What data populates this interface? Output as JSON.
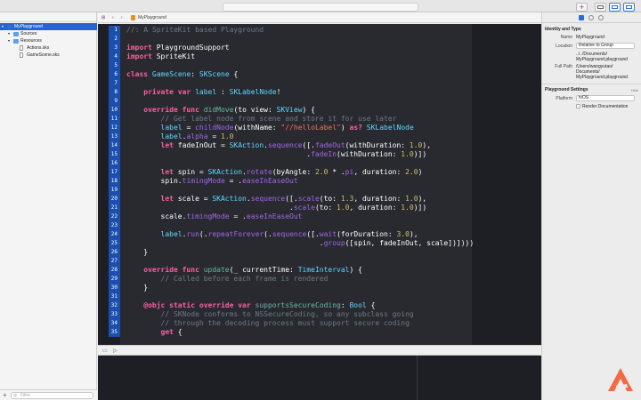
{
  "jumpbar": {
    "project": "MyPlayground"
  },
  "navigator": {
    "items": [
      {
        "label": "MyPlayground",
        "level": 0,
        "icon": "project-icon",
        "selected": true
      },
      {
        "label": "Sources",
        "level": 1,
        "icon": "folder-icon"
      },
      {
        "label": "Resources",
        "level": 1,
        "icon": "folder-icon"
      },
      {
        "label": "Actions.sks",
        "level": 2,
        "icon": "file-icon"
      },
      {
        "label": "GameScene.sks",
        "level": 2,
        "icon": "file-icon"
      }
    ],
    "filter_placeholder": "Filter"
  },
  "editor": {
    "lines": [
      [
        [
          "cm",
          "//: A SpriteKit based Playground"
        ]
      ],
      [],
      [
        [
          "kw",
          "import"
        ],
        [
          "pl",
          " PlaygroundSupport"
        ]
      ],
      [
        [
          "kw",
          "import"
        ],
        [
          "pl",
          " SpriteKit"
        ]
      ],
      [],
      [
        [
          "kw",
          "class"
        ],
        [
          "pl",
          " "
        ],
        [
          "ty",
          "GameScene"
        ],
        [
          "pl",
          ": "
        ],
        [
          "ty",
          "SKScene"
        ],
        [
          "pl",
          " {"
        ]
      ],
      [],
      [
        [
          "pl",
          "    "
        ],
        [
          "kw",
          "private var"
        ],
        [
          "pl",
          " "
        ],
        [
          "ty",
          "label"
        ],
        [
          "pl",
          " : "
        ],
        [
          "ty",
          "SKLabelNode"
        ],
        [
          "pl",
          "!"
        ]
      ],
      [],
      [
        [
          "pl",
          "    "
        ],
        [
          "kw",
          "override func"
        ],
        [
          "pl",
          " "
        ],
        [
          "fn",
          "didMove"
        ],
        [
          "pl",
          "(to view: "
        ],
        [
          "ty",
          "SKView"
        ],
        [
          "pl",
          ") {"
        ]
      ],
      [
        [
          "pl",
          "        "
        ],
        [
          "cm",
          "// Get label node from scene and store it for use later"
        ]
      ],
      [
        [
          "pl",
          "        "
        ],
        [
          "ty",
          "label"
        ],
        [
          "pl",
          " = "
        ],
        [
          "mb",
          "childNode"
        ],
        [
          "pl",
          "(withName: "
        ],
        [
          "st",
          "\"//helloLabel\""
        ],
        [
          "pl",
          ") "
        ],
        [
          "kw",
          "as?"
        ],
        [
          "pl",
          " "
        ],
        [
          "ty",
          "SKLabelNode"
        ]
      ],
      [
        [
          "pl",
          "        "
        ],
        [
          "ty",
          "label"
        ],
        [
          "pl",
          "."
        ],
        [
          "mb",
          "alpha"
        ],
        [
          "pl",
          " = "
        ],
        [
          "nu",
          "1.0"
        ]
      ],
      [
        [
          "pl",
          "        "
        ],
        [
          "kw",
          "let"
        ],
        [
          "pl",
          " fadeInOut = "
        ],
        [
          "ty",
          "SKAction"
        ],
        [
          "pl",
          "."
        ],
        [
          "mb",
          "sequence"
        ],
        [
          "pl",
          "([."
        ],
        [
          "mb",
          "fadeOut"
        ],
        [
          "pl",
          "(withDuration: "
        ],
        [
          "nu",
          "1.0"
        ],
        [
          "pl",
          "),"
        ]
      ],
      [
        [
          "pl",
          "                                          ."
        ],
        [
          "mb",
          "fadeIn"
        ],
        [
          "pl",
          "(withDuration: "
        ],
        [
          "nu",
          "1.0"
        ],
        [
          "pl",
          ")])"
        ]
      ],
      [],
      [
        [
          "pl",
          "        "
        ],
        [
          "kw",
          "let"
        ],
        [
          "pl",
          " spin = "
        ],
        [
          "ty",
          "SKAction"
        ],
        [
          "pl",
          "."
        ],
        [
          "mb",
          "rotate"
        ],
        [
          "pl",
          "(byAngle: "
        ],
        [
          "nu",
          "2.0"
        ],
        [
          "pl",
          " * ."
        ],
        [
          "mb",
          "pi"
        ],
        [
          "pl",
          ", duration: "
        ],
        [
          "nu",
          "2.0"
        ],
        [
          "pl",
          ")"
        ]
      ],
      [
        [
          "pl",
          "        spin."
        ],
        [
          "mb",
          "timingMode"
        ],
        [
          "pl",
          " = ."
        ],
        [
          "mb",
          "easeInEaseOut"
        ]
      ],
      [],
      [
        [
          "pl",
          "        "
        ],
        [
          "kw",
          "let"
        ],
        [
          "pl",
          " scale = "
        ],
        [
          "ty",
          "SKAction"
        ],
        [
          "pl",
          "."
        ],
        [
          "mb",
          "sequence"
        ],
        [
          "pl",
          "([."
        ],
        [
          "mb",
          "scale"
        ],
        [
          "pl",
          "(to: "
        ],
        [
          "nu",
          "1.3"
        ],
        [
          "pl",
          ", duration: "
        ],
        [
          "nu",
          "1.0"
        ],
        [
          "pl",
          "),"
        ]
      ],
      [
        [
          "pl",
          "                                      ."
        ],
        [
          "mb",
          "scale"
        ],
        [
          "pl",
          "(to: "
        ],
        [
          "nu",
          "1.0"
        ],
        [
          "pl",
          ", duration: "
        ],
        [
          "nu",
          "1.0"
        ],
        [
          "pl",
          ")])"
        ]
      ],
      [
        [
          "pl",
          "        scale."
        ],
        [
          "mb",
          "timingMode"
        ],
        [
          "pl",
          " = ."
        ],
        [
          "mb",
          "easeInEaseOut"
        ]
      ],
      [],
      [
        [
          "pl",
          "        "
        ],
        [
          "ty",
          "label"
        ],
        [
          "pl",
          "."
        ],
        [
          "mb",
          "run"
        ],
        [
          "pl",
          "(."
        ],
        [
          "mb",
          "repeatForever"
        ],
        [
          "pl",
          "(."
        ],
        [
          "mb",
          "sequence"
        ],
        [
          "pl",
          "([."
        ],
        [
          "mb",
          "wait"
        ],
        [
          "pl",
          "(forDuration: "
        ],
        [
          "nu",
          "3.0"
        ],
        [
          "pl",
          "),"
        ]
      ],
      [
        [
          "pl",
          "                                             ."
        ],
        [
          "mb",
          "group"
        ],
        [
          "pl",
          "([spin, fadeInOut, scale])])))"
        ]
      ],
      [
        [
          "pl",
          "    }"
        ]
      ],
      [],
      [
        [
          "pl",
          "    "
        ],
        [
          "kw",
          "override func"
        ],
        [
          "pl",
          " "
        ],
        [
          "fn",
          "update"
        ],
        [
          "pl",
          "(_ currentTime: "
        ],
        [
          "ty",
          "TimeInterval"
        ],
        [
          "pl",
          ") {"
        ]
      ],
      [
        [
          "pl",
          "        "
        ],
        [
          "cm",
          "// Called before each frame is rendered"
        ]
      ],
      [
        [
          "pl",
          "    }"
        ]
      ],
      [],
      [
        [
          "pl",
          "    "
        ],
        [
          "kw",
          "@objc static override var"
        ],
        [
          "pl",
          " "
        ],
        [
          "fn",
          "supportsSecureCoding"
        ],
        [
          "pl",
          ": "
        ],
        [
          "ty",
          "Bool"
        ],
        [
          "pl",
          " {"
        ]
      ],
      [
        [
          "pl",
          "        "
        ],
        [
          "cm",
          "// SKNode conforms to NSSecureCoding, so any subclass going"
        ]
      ],
      [
        [
          "pl",
          "        "
        ],
        [
          "cm",
          "// through the decoding process must support secure coding"
        ]
      ],
      [
        [
          "pl",
          "        "
        ],
        [
          "kw",
          "get"
        ],
        [
          "pl",
          " {"
        ]
      ]
    ]
  },
  "inspector": {
    "identity_title": "Identity and Type",
    "name_label": "Name",
    "name_value": "MyPlayground",
    "location_label": "Location",
    "location_value": "Relative to Group",
    "path_lines": [
      "../../Documents/",
      "MyPlayground.playground"
    ],
    "fullpath_label": "Full Path",
    "fullpath_lines": [
      "/Users/wangyutao/",
      "Documents/",
      "MyPlayground.playground"
    ],
    "settings_title": "Playground Settings",
    "hide_label": "Hide",
    "platform_label": "Platform",
    "platform_value": "tvOS",
    "render_label": "Render Documentation"
  }
}
